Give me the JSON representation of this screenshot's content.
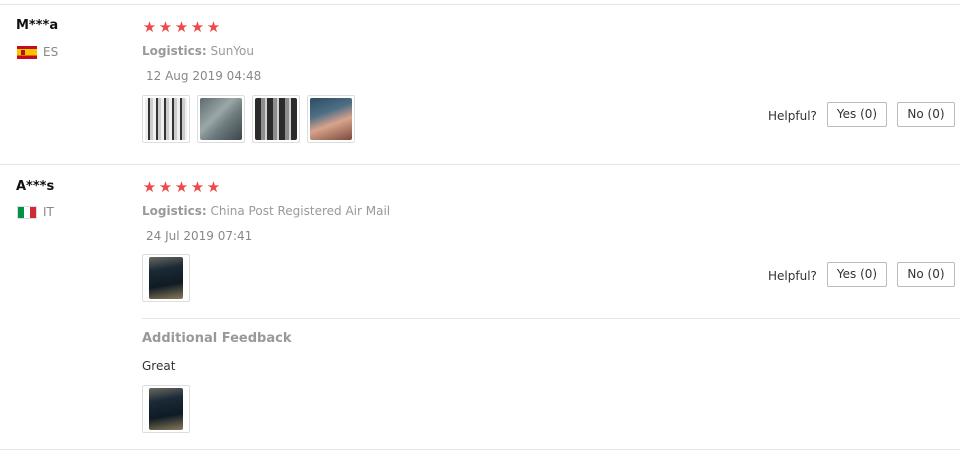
{
  "reviews": [
    {
      "user": "M***a",
      "country_code": "ES",
      "flag_icon": "spain-flag-icon",
      "rating": 5,
      "logistics_label": "Logistics:",
      "logistics_value": "SunYou",
      "date": "12 Aug 2019 04:48",
      "images": [
        "review-photo-1",
        "review-photo-2",
        "review-photo-3",
        "review-photo-4"
      ],
      "helpful_label": "Helpful?",
      "yes_label": "Yes (0)",
      "no_label": "No (0)"
    },
    {
      "user": "A***s",
      "country_code": "IT",
      "flag_icon": "italy-flag-icon",
      "rating": 5,
      "logistics_label": "Logistics:",
      "logistics_value": "China Post Registered Air Mail",
      "date": "24 Jul 2019 07:41",
      "images": [
        "review-photo-1"
      ],
      "helpful_label": "Helpful?",
      "yes_label": "Yes (0)",
      "no_label": "No (0)",
      "additional_feedback": {
        "title": "Additional Feedback",
        "text": "Great",
        "images": [
          "feedback-photo-1"
        ]
      }
    }
  ],
  "star_glyph": "★",
  "colors": {
    "star": "#f04848",
    "divider": "#e6e6e6",
    "muted": "#999999"
  }
}
